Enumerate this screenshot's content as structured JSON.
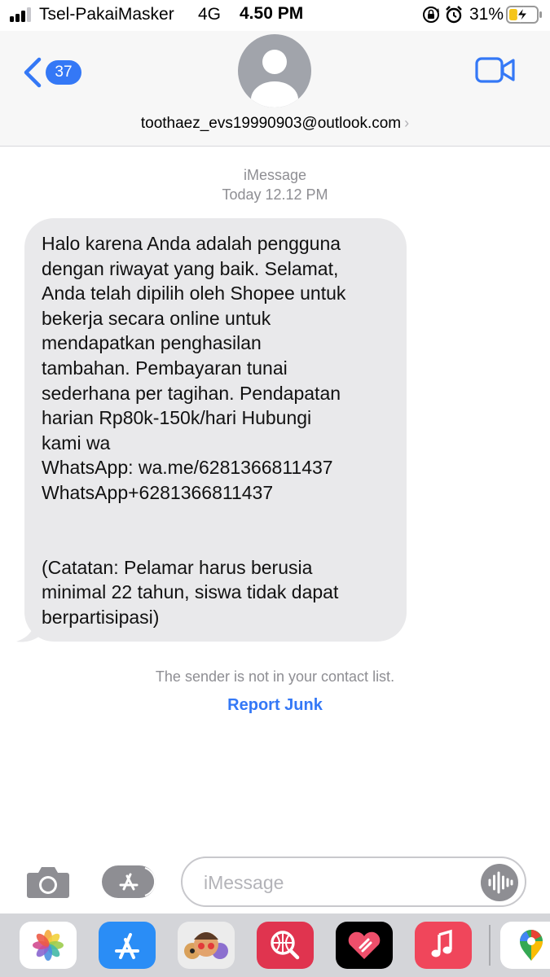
{
  "status_bar": {
    "carrier": "Tsel-PakaiMasker",
    "network": "4G",
    "time": "4.50 PM",
    "battery_percent": "31%",
    "signal_bars": 3,
    "battery_level": 0.31,
    "icons": [
      "signal-icon",
      "lock-rotation-icon",
      "alarm-icon",
      "battery-charging-icon"
    ]
  },
  "header": {
    "back_badge": "37",
    "contact": "toothaez_evs19990903@outlook.com",
    "contact_chevron": "›",
    "icons": [
      "back-chevron-icon",
      "avatar-person-icon",
      "video-camera-icon"
    ]
  },
  "thread": {
    "service": "iMessage",
    "timestamp": "Today 12.12 PM",
    "message_lines_1": [
      "Halo karena Anda adalah pengguna",
      "dengan riwayat yang baik. Selamat,",
      "Anda telah dipilih oleh Shopee untuk",
      "bekerja secara online untuk",
      "mendapatkan penghasilan",
      "tambahan. Pembayaran tunai",
      "sederhana per tagihan. Pendapatan",
      "harian Rp80k-150k/hari Hubungi",
      "kami wa",
      "WhatsApp: wa.me/6281366811437",
      "WhatsApp+6281366811437"
    ],
    "message_lines_2": [
      "(Catatan: Pelamar harus berusia",
      "minimal 22 tahun, siswa tidak dapat",
      "berpartisipasi)"
    ],
    "notice": "The sender is not in your contact list.",
    "report_junk": "Report Junk"
  },
  "input_bar": {
    "placeholder": "iMessage",
    "icons": [
      "camera-icon",
      "app-store-icon",
      "dictation-icon"
    ]
  },
  "app_drawer": {
    "apps": [
      "photos-app-icon",
      "app-store-app-icon",
      "memoji-app-icon",
      "web-search-app-icon",
      "digital-touch-app-icon",
      "music-app-icon",
      "maps-app-icon"
    ]
  },
  "colors": {
    "accent": "#3478f6",
    "bubble": "#e9e9eb",
    "secondary_text": "#8e8e93",
    "header_bg": "#f7f7f7",
    "drawer_bg": "#d4d5d9"
  }
}
